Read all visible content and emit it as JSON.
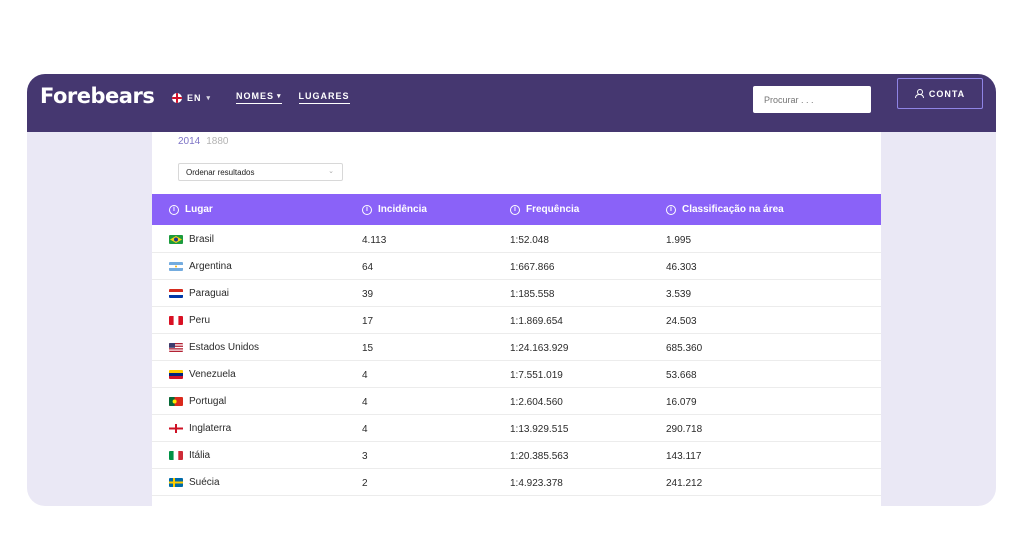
{
  "header": {
    "logo": "Forebears",
    "language": "EN",
    "nav": [
      {
        "label": "NOMES",
        "has_dropdown": true
      },
      {
        "label": "LUGARES",
        "has_dropdown": false
      }
    ],
    "search_placeholder": "Procurar . . .",
    "account_label": "CONTA"
  },
  "years": {
    "active": "2014",
    "inactive": "1880"
  },
  "sort": {
    "label": "Ordenar resultados"
  },
  "table": {
    "columns": [
      "Lugar",
      "Incidência",
      "Frequência",
      "Classificação na área"
    ],
    "rows": [
      {
        "place": "Brasil",
        "flag": "brazil-flag-icon",
        "incidence": "4.113",
        "frequency": "1:52.048",
        "rank": "1.995"
      },
      {
        "place": "Argentina",
        "flag": "argentina-flag-icon",
        "incidence": "64",
        "frequency": "1:667.866",
        "rank": "46.303"
      },
      {
        "place": "Paraguai",
        "flag": "paraguay-flag-icon",
        "incidence": "39",
        "frequency": "1:185.558",
        "rank": "3.539"
      },
      {
        "place": "Peru",
        "flag": "peru-flag-icon",
        "incidence": "17",
        "frequency": "1:1.869.654",
        "rank": "24.503"
      },
      {
        "place": "Estados Unidos",
        "flag": "usa-flag-icon",
        "incidence": "15",
        "frequency": "1:24.163.929",
        "rank": "685.360"
      },
      {
        "place": "Venezuela",
        "flag": "venezuela-flag-icon",
        "incidence": "4",
        "frequency": "1:7.551.019",
        "rank": "53.668"
      },
      {
        "place": "Portugal",
        "flag": "portugal-flag-icon",
        "incidence": "4",
        "frequency": "1:2.604.560",
        "rank": "16.079"
      },
      {
        "place": "Inglaterra",
        "flag": "england-flag-icon",
        "incidence": "4",
        "frequency": "1:13.929.515",
        "rank": "290.718"
      },
      {
        "place": "Itália",
        "flag": "italy-flag-icon",
        "incidence": "3",
        "frequency": "1:20.385.563",
        "rank": "143.117"
      },
      {
        "place": "Suécia",
        "flag": "sweden-flag-icon",
        "incidence": "2",
        "frequency": "1:4.923.378",
        "rank": "241.212"
      }
    ]
  },
  "colors": {
    "header_bg": "#453770",
    "table_header_bg": "#8a62f8",
    "window_bg": "#eae8f5",
    "year_active": "#7d73c6"
  }
}
